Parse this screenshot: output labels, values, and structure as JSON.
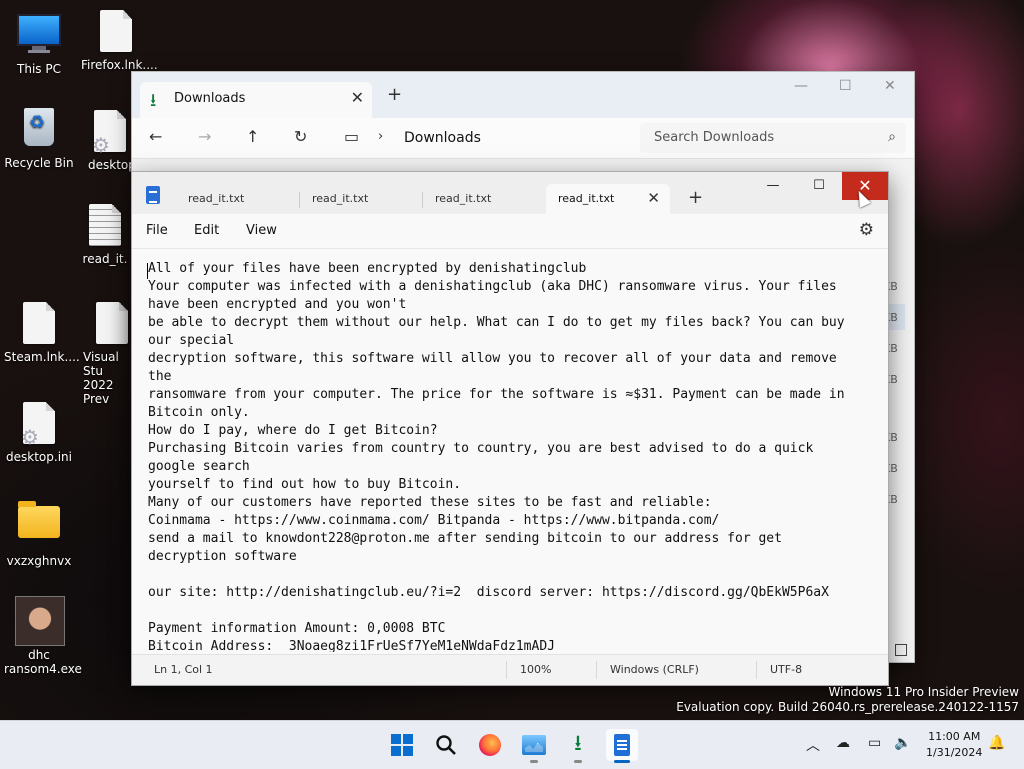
{
  "desktop": {
    "icons": [
      {
        "label": "This PC",
        "icon": "computer-icon"
      },
      {
        "label": "Firefox.lnk....",
        "icon": "file-icon"
      },
      {
        "label": "Recycle Bin",
        "icon": "recycle-bin-icon"
      },
      {
        "label": "desktop",
        "icon": "settings-file-icon"
      },
      {
        "label": "read_it.",
        "icon": "text-file-icon"
      },
      {
        "label": "Steam.lnk....",
        "icon": "file-icon"
      },
      {
        "label": "Visual Stu",
        "label2": "2022 Prev",
        "icon": "file-icon"
      },
      {
        "label": "desktop.ini",
        "icon": "settings-file-icon"
      },
      {
        "label": "vxzxghnvx",
        "icon": "folder-icon"
      },
      {
        "label": "dhc",
        "label2": "ransom4.exe",
        "icon": "photo-avatar-icon"
      }
    ]
  },
  "explorer": {
    "tab_label": "Downloads",
    "breadcrumb": "Downloads",
    "search_placeholder": "Search Downloads",
    "size_suffix": "KB",
    "accent": "#0a7d3b"
  },
  "notepad": {
    "tabs": [
      {
        "label": "read_it.txt",
        "active": false
      },
      {
        "label": "read_it.txt",
        "active": false
      },
      {
        "label": "read_it.txt",
        "active": false
      },
      {
        "label": "read_it.txt",
        "active": true
      }
    ],
    "menu": {
      "file": "File",
      "edit": "Edit",
      "view": "View"
    },
    "lines": [
      "All of your files have been encrypted by denishatingclub",
      "Your computer was infected with a denishatingclub (aka DHC) ransomware virus. Your files",
      "have been encrypted and you won't",
      "be able to decrypt them without our help. What can I do to get my files back? You can buy",
      "our special",
      "decryption software, this software will allow you to recover all of your data and remove",
      "the",
      "ransomware from your computer. The price for the software is ≈$31. Payment can be made in",
      "Bitcoin only.",
      "How do I pay, where do I get Bitcoin?",
      "Purchasing Bitcoin varies from country to country, you are best advised to do a quick",
      "google search",
      "yourself to find out how to buy Bitcoin.",
      "Many of our customers have reported these sites to be fast and reliable:",
      "Coinmama - https://www.coinmama.com/ Bitpanda - https://www.bitpanda.com/",
      "send a mail to knowdont228@proton.me after sending bitcoin to our address for get",
      "decryption software",
      "",
      "our site: http://denishatingclub.eu/?i=2  discord server: https://discord.gg/QbEkW5P6aX",
      "",
      "Payment information Amount: 0,0008 BTC",
      "Bitcoin Address:  3Noaeg8zi1FrUeSf7YeM1eNWdaFdz1mADJ"
    ],
    "status": {
      "position": "Ln 1, Col 1",
      "zoom": "100%",
      "line_ending": "Windows (CRLF)",
      "encoding": "UTF-8"
    },
    "close_color": "#c42b1c"
  },
  "watermark": {
    "line1": "Windows 11 Pro Insider Preview",
    "line2": "Evaluation copy. Build 26040.rs_prerelease.240122-1157"
  },
  "taskbar": {
    "apps": [
      "start-icon",
      "search-icon",
      "firefox-icon",
      "task-manager-icon",
      "downloads-icon",
      "notepad-icon"
    ],
    "time": "11:00 AM",
    "date": "1/31/2024"
  }
}
